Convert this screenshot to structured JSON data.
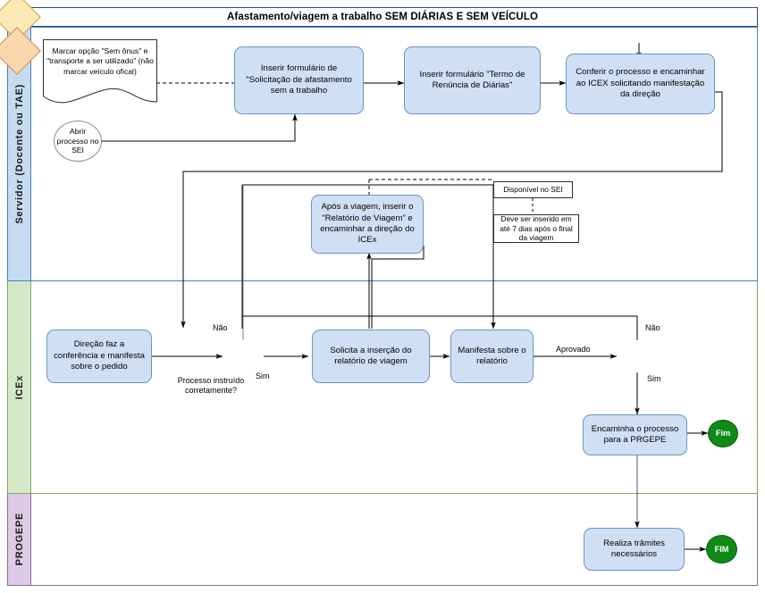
{
  "pool": {
    "title": "Afastamento/viagem a trabalho SEM DIÁRIAS E SEM VEÍCULO"
  },
  "lanes": [
    {
      "id": "servidor",
      "label": "Servidor (Docente ou TAE)",
      "color": "#c5dcf0"
    },
    {
      "id": "icex",
      "label": "ICEx",
      "color": "#d6e9c6"
    },
    {
      "id": "progepe",
      "label": "PROGEPE",
      "color": "#ddcbe6"
    }
  ],
  "nodes": {
    "note_marcar": "Marcar opção \"Sem ônus\" e \"transporte a ser utilizado\" (não marcar veículo ofical)",
    "start_sei": "Abrir processo no SEI",
    "inserir_solicitacao": "Inserir formulário de \"Solicitação de afastamento sem a trabalho",
    "inserir_termo": "Inserir formulário \"Termo de Renúncia de Diárias\"",
    "conferir_processo": "Conferir o processo e encaminhar ao ICEX solicitando manifestação da direção",
    "relatorio_viagem": "Após a viagem, inserir o \"Relatório de Viagem\" e encaminhar a direção do ICEx",
    "note_disponivel": "Disponível no SEI",
    "note_prazo": "Deve ser inserido em até 7 dias após o final da viagem",
    "direcao_confere": "Direção faz a conferência e manifesta sobre o pedido",
    "decisao_instruido": "Processo instruído corretamente?",
    "solicita_insercao": "Solicita a inserção do relatório de viagem",
    "manifesta_relatorio": "Manifesta sobre o relatório",
    "encaminha_prgepe": "Encaminha o processo para a PRGEPE",
    "fim_icex": "Fim",
    "realiza_tramites": "Realiza trâmites necessários",
    "fim_progepe": "FIM"
  },
  "edge_labels": {
    "nao_1": "Não",
    "sim_1": "Sim",
    "aprovado": "Aprovado",
    "nao_2": "Não",
    "sim_2": "Sim"
  },
  "colors": {
    "pool_border": "#23478b",
    "lane_servidor": "#c5dcf0",
    "lane_icex": "#d6e9c6",
    "lane_progepe": "#ddcbe6",
    "task_fill": "#cfe0f5",
    "task_border": "#6b93c8",
    "decision_yellow": "#fde9b5",
    "decision_peach": "#fbd7b0",
    "end_green": "#0f8a16",
    "connector": "#000000"
  }
}
